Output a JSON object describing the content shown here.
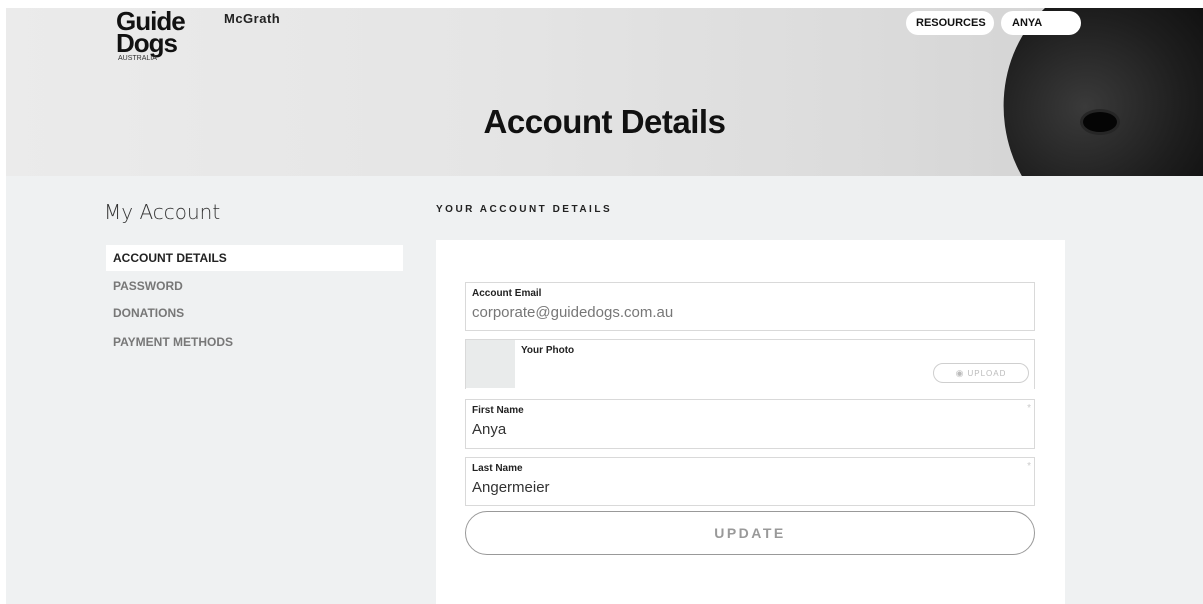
{
  "header": {
    "logo": {
      "line1": "Guide",
      "line2": "Dogs",
      "sub": "AUSTRALIA",
      "partner": "McGrath"
    },
    "nav": {
      "resources": "RESOURCES",
      "user": "ANYA"
    },
    "page_title": "Account Details"
  },
  "sidebar": {
    "title": "My Account",
    "items": [
      {
        "label": "ACCOUNT DETAILS",
        "active": true
      },
      {
        "label": "PASSWORD",
        "active": false
      },
      {
        "label": "DONATIONS",
        "active": false
      },
      {
        "label": "PAYMENT METHODS",
        "active": false
      }
    ]
  },
  "main": {
    "section_heading": "YOUR ACCOUNT DETAILS",
    "email": {
      "label": "Account Email",
      "value": "corporate@guidedogs.com.au"
    },
    "photo": {
      "label": "Your Photo",
      "upload_label": "UPLOAD",
      "upload_icon": "camera-icon"
    },
    "first_name": {
      "label": "First Name",
      "value": "Anya",
      "required_mark": "*"
    },
    "last_name": {
      "label": "Last Name",
      "value": "Angermeier",
      "required_mark": "*"
    },
    "update_label": "UPDATE"
  },
  "colors": {
    "background": "#eff1f2",
    "card": "#ffffff",
    "active_item_bg": "#ffffff",
    "muted_text": "#777777"
  }
}
